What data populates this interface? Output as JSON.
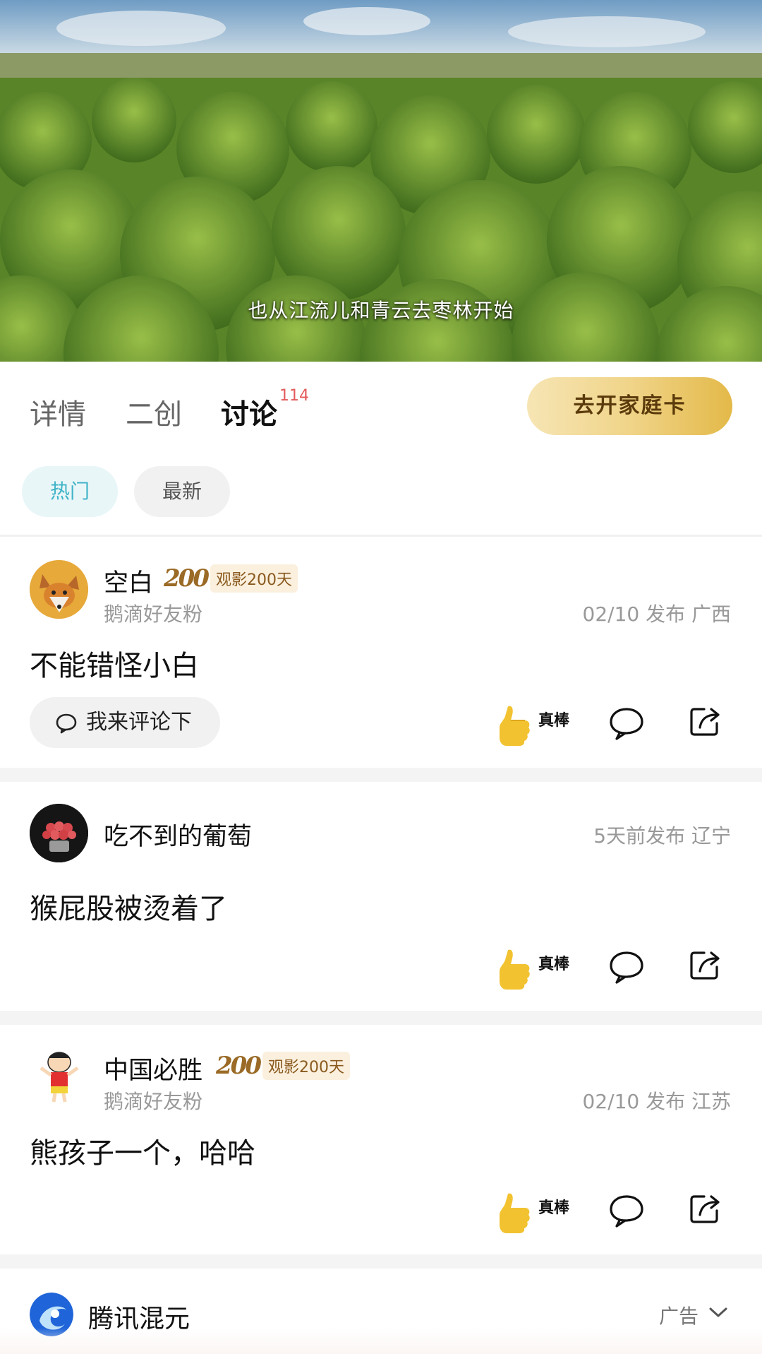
{
  "video": {
    "subtitle": "也从江流儿和青云去枣林开始"
  },
  "tabs": {
    "items": [
      "详情",
      "二创",
      "讨论"
    ],
    "active": "讨论",
    "discussion_count": "114",
    "family_card_button": "去开家庭卡"
  },
  "filters": {
    "hot": "热门",
    "new": "最新",
    "active": "热门"
  },
  "posts": [
    {
      "username": "空白",
      "medal_number": "200",
      "medal_label": "观影200天",
      "fan_label": "鹅滴好友粉",
      "meta": "02/10 发布 广西",
      "content": "不能错怪小白",
      "reply_placeholder": "我来评论下",
      "like_label": "真棒"
    },
    {
      "username": "吃不到的葡萄",
      "meta": "5天前发布 辽宁",
      "content": "猴屁股被烫着了",
      "like_label": "真棒"
    },
    {
      "username": "中国必胜",
      "medal_number": "200",
      "medal_label": "观影200天",
      "fan_label": "鹅滴好友粉",
      "meta": "02/10 发布 江苏",
      "content": "熊孩子一个，哈哈",
      "like_label": "真棒"
    }
  ],
  "ad": {
    "name": "腾讯混元",
    "label": "广告"
  },
  "icons": [
    "thumbs-up-icon",
    "comment-bubble-icon",
    "share-icon",
    "chevron-down-icon"
  ],
  "colors": {
    "accent_hot": "#3fb3c7",
    "badge_red": "#e35a5a",
    "gold_button_start": "#f6e5b4",
    "gold_button_end": "#e3b949",
    "thumb_yellow": "#f2c230"
  }
}
